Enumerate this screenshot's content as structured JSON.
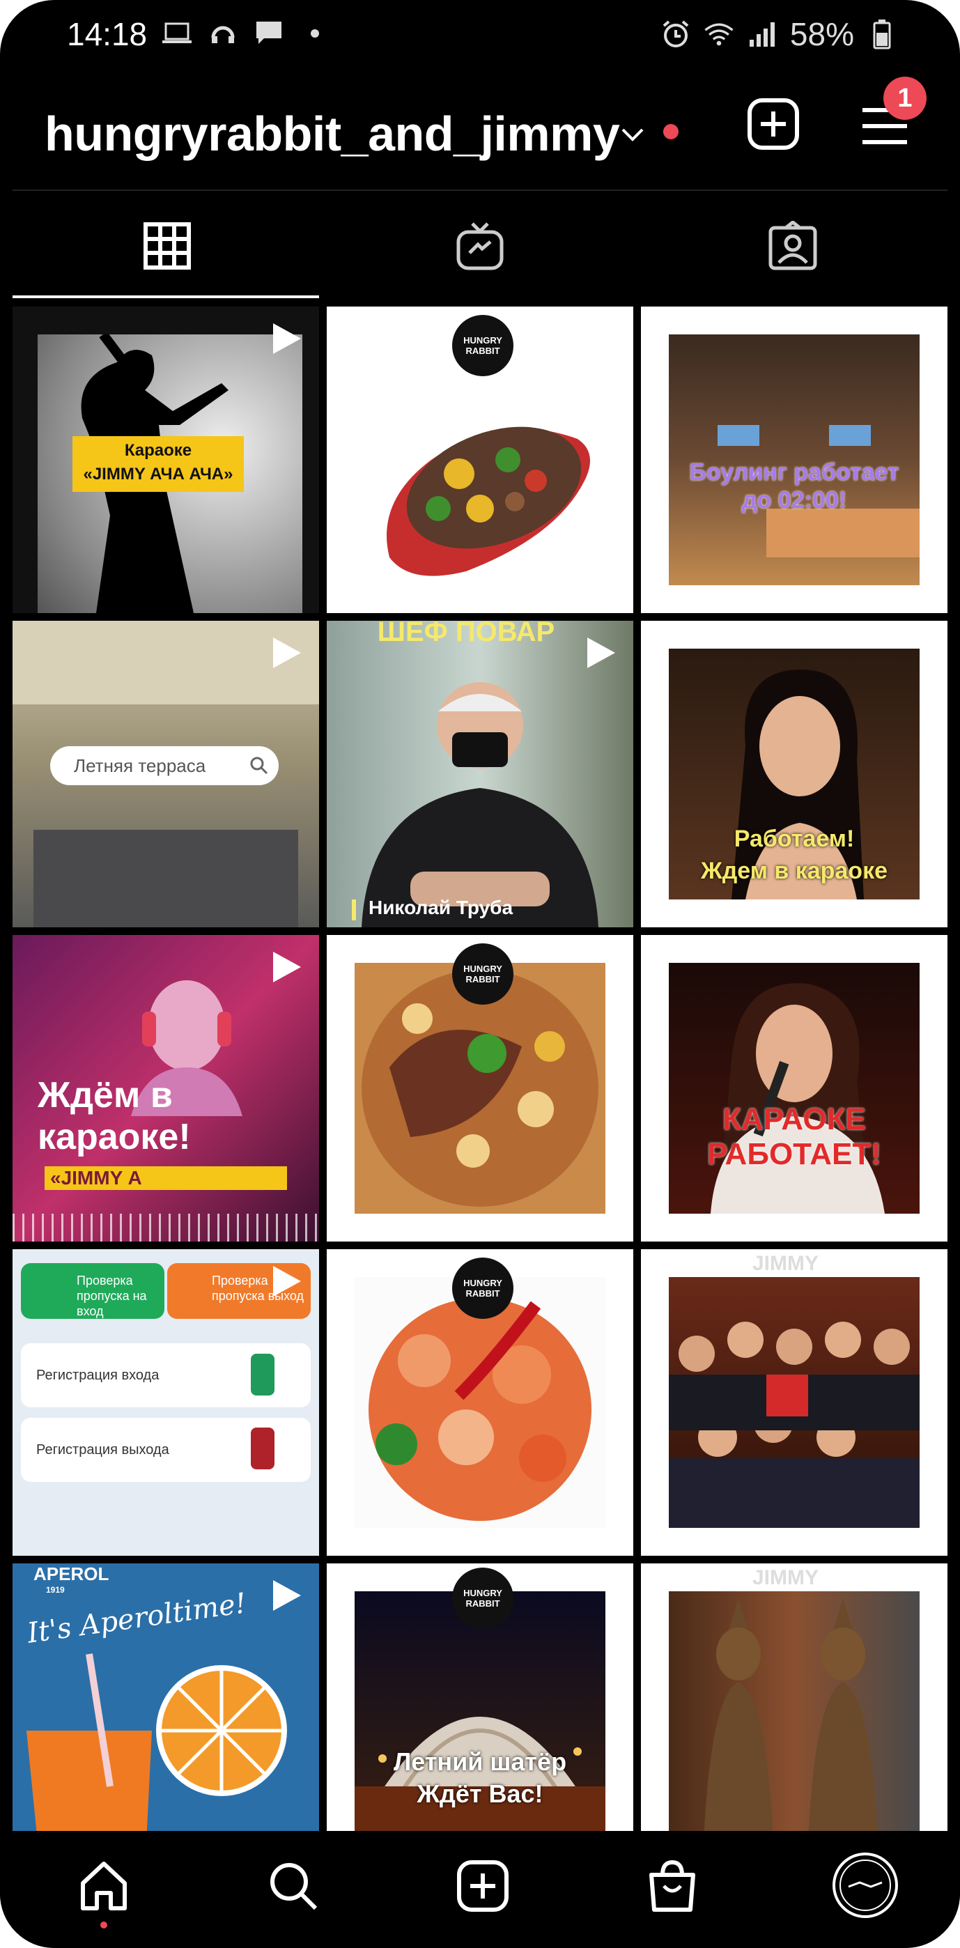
{
  "status_bar": {
    "time": "14:18",
    "battery": "58%"
  },
  "header": {
    "username": "hungryrabbit_and_jimmy",
    "notification_count": "1"
  },
  "tabs": [
    {
      "icon": "grid-icon",
      "active": true
    },
    {
      "icon": "igtv-icon",
      "active": false
    },
    {
      "icon": "tagged-icon",
      "active": false
    }
  ],
  "grid": {
    "post1": {
      "caption_line1": "Караоке",
      "caption_line2": "«JIMMY АЧА АЧА»",
      "video": true
    },
    "post2": {
      "logo_text": "HUNGRY RABBIT",
      "video": false
    },
    "post3": {
      "caption_line1": "Боулинг работает",
      "caption_line2": "до 02:00!",
      "video": false
    },
    "post4": {
      "search_text": "Летняя терраса",
      "video": true
    },
    "post5": {
      "top_text": "ШЕФ ПОВАР",
      "name": "Николай Труба",
      "video": true
    },
    "post6": {
      "caption_line1": "Работаем!",
      "caption_line2": "Ждем в караоке",
      "video": false
    },
    "post7": {
      "caption_line1": "Ждём в",
      "caption_line2": "караоке!",
      "caption_line3": "«JIMMY А",
      "video": true
    },
    "post8": {
      "logo_text": "HUNGRY RABBIT",
      "video": false
    },
    "post9": {
      "caption_line1": "КАРАОКЕ",
      "caption_line2": "РАБОТАЕТ!",
      "video": false
    },
    "post10": {
      "btn_in": "Проверка пропуска на вход",
      "btn_out": "Проверка пропуска выход",
      "reg_in": "Регистрация входа",
      "reg_out": "Регистрация выхода",
      "video": true
    },
    "post11": {
      "logo_text": "HUNGRY RABBIT",
      "video": false
    },
    "post12": {
      "watermark": "JIMMY",
      "video": false
    },
    "post13": {
      "brand": "APEROL",
      "brand_year": "1919",
      "slogan": "It's Aperoltime!",
      "video": true
    },
    "post14": {
      "logo_text": "HUNGRY RABBIT",
      "caption_line1": "Летний шатёр",
      "caption_line2": "Ждёт Вас!",
      "video": false
    },
    "post15": {
      "watermark": "JIMMY",
      "video": false
    }
  },
  "bottom_nav": [
    "home-icon",
    "search-icon",
    "create-icon",
    "shop-icon",
    "profile-avatar"
  ],
  "colors": {
    "background": "#000000",
    "text": "#ffffff",
    "notification": "#ed4956",
    "yellow_label": "#f5c518"
  }
}
